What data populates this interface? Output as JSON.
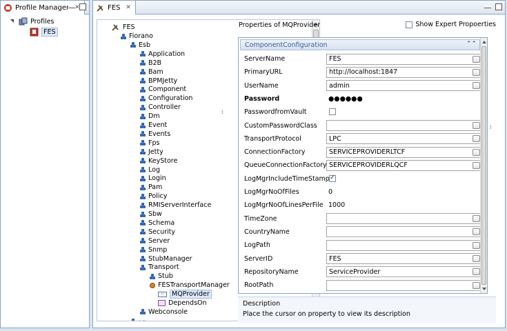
{
  "profile_manager": {
    "tab_title": "Profile Manager",
    "tree": [
      {
        "label": "Profiles",
        "expanded": true,
        "icon": "profiles-icon"
      },
      {
        "label": "FES",
        "icon": "server-icon",
        "selected": true
      }
    ]
  },
  "editor": {
    "tab_title": "FES",
    "tree": {
      "root": "FES",
      "nodes": [
        {
          "label": "Fiorano",
          "depth": 1
        },
        {
          "label": "Esb",
          "depth": 2
        },
        {
          "label": "Application",
          "depth": 3
        },
        {
          "label": "B2B",
          "depth": 3
        },
        {
          "label": "Bam",
          "depth": 3
        },
        {
          "label": "BPMJetty",
          "depth": 3
        },
        {
          "label": "Component",
          "depth": 3
        },
        {
          "label": "Configuration",
          "depth": 3
        },
        {
          "label": "Controller",
          "depth": 3
        },
        {
          "label": "Dm",
          "depth": 3
        },
        {
          "label": "Event",
          "depth": 3
        },
        {
          "label": "Events",
          "depth": 3
        },
        {
          "label": "Fps",
          "depth": 3
        },
        {
          "label": "Jetty",
          "depth": 3
        },
        {
          "label": "KeyStore",
          "depth": 3
        },
        {
          "label": "Log",
          "depth": 3
        },
        {
          "label": "Login",
          "depth": 3
        },
        {
          "label": "Pam",
          "depth": 3
        },
        {
          "label": "Policy",
          "depth": 3
        },
        {
          "label": "RMIServerInterface",
          "depth": 3
        },
        {
          "label": "Sbw",
          "depth": 3
        },
        {
          "label": "Schema",
          "depth": 3
        },
        {
          "label": "Security",
          "depth": 3
        },
        {
          "label": "Server",
          "depth": 3
        },
        {
          "label": "Snmp",
          "depth": 3
        },
        {
          "label": "StubManager",
          "depth": 3
        },
        {
          "label": "Transport",
          "depth": 3
        },
        {
          "label": "Stub",
          "depth": 4
        },
        {
          "label": "FESTransportManager",
          "depth": 4
        },
        {
          "label": "MQProvider",
          "depth": 5,
          "selected": true
        },
        {
          "label": "DependsOn",
          "depth": 5
        },
        {
          "label": "Webconsole",
          "depth": 3
        }
      ]
    },
    "properties": {
      "title": "Properties of MQProvider",
      "show_expert_label": "Show Expert Propoerties",
      "show_expert_checked": false,
      "section": "ComponentConfiguration",
      "rows": [
        {
          "label": "ServerName",
          "value": "FES",
          "kind": "text"
        },
        {
          "label": "PrimaryURL",
          "value": "http://localhost:1847",
          "kind": "text"
        },
        {
          "label": "UserName",
          "value": "admin",
          "kind": "text"
        },
        {
          "label": "Password",
          "value": "●●●●●●",
          "kind": "password",
          "bold": true
        },
        {
          "label": "PasswordfromVault",
          "value": "",
          "kind": "checkbox",
          "checked": false
        },
        {
          "label": "CustomPasswordClass",
          "value": "",
          "kind": "text"
        },
        {
          "label": "TransportProtocol",
          "value": "LPC",
          "kind": "text"
        },
        {
          "label": "ConnectionFactory",
          "value": "SERVICEPROVIDERLTCF",
          "kind": "text"
        },
        {
          "label": "QueueConnectionFactory",
          "value": "SERVICEPROVIDERLQCF",
          "kind": "text"
        },
        {
          "label": "LogMgrIncludeTimeStamp",
          "value": "",
          "kind": "checkbox",
          "checked": true
        },
        {
          "label": "LogMgrNoOfFiles",
          "value": "0",
          "kind": "plain"
        },
        {
          "label": "LogMgrNoOfLinesPerFile",
          "value": "1000",
          "kind": "plain"
        },
        {
          "label": "TimeZone",
          "value": "",
          "kind": "text"
        },
        {
          "label": "CountryName",
          "value": "",
          "kind": "text"
        },
        {
          "label": "LogPath",
          "value": "",
          "kind": "text"
        },
        {
          "label": "ServerID",
          "value": "FES",
          "kind": "text"
        },
        {
          "label": "RepositoryName",
          "value": "ServiceProvider",
          "kind": "text"
        },
        {
          "label": "RootPath",
          "value": "",
          "kind": "text"
        }
      ]
    },
    "description": {
      "title": "Description",
      "text": "Place the cursor on property to view its description"
    }
  }
}
